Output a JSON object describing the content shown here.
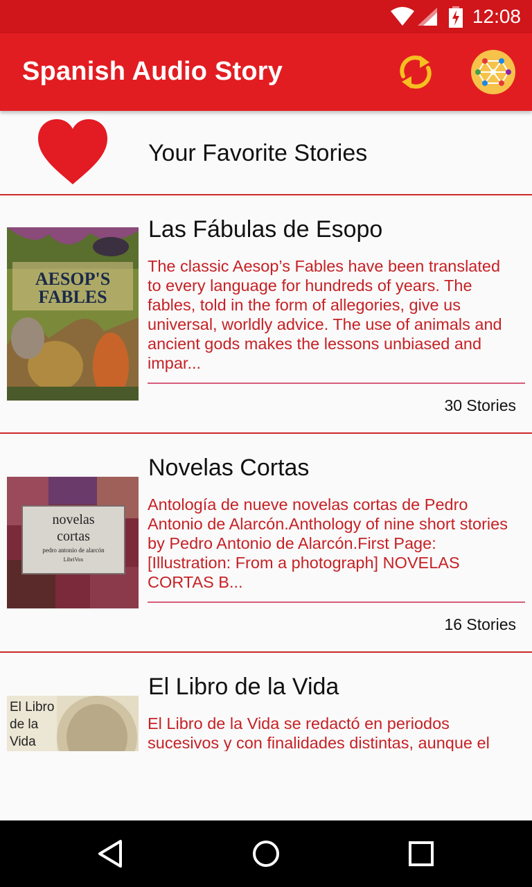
{
  "status_bar": {
    "time": "12:08"
  },
  "app_bar": {
    "title": "Spanish Audio Story"
  },
  "favorites": {
    "label": "Your Favorite Stories"
  },
  "stories": [
    {
      "title": "Las Fábulas de Esopo",
      "description": "The classic Aesop’s Fables have been translated to every language for hundreds of years. The fables, told in the form of allegories, give us universal, worldly advice. The use of animals and ancient gods makes the lessons unbiased and impar...",
      "count": "30 Stories",
      "cover_text": [
        "AESOP'S",
        "FABLES"
      ]
    },
    {
      "title": "Novelas Cortas",
      "description": "Antología de nueve novelas cortas de Pedro Antonio de Alarcón.Anthology of nine short stories by Pedro Antonio de Alarcón.First Page: [Illustration: From a photograph] NOVELAS CORTAS B...",
      "count": "16 Stories",
      "cover_text": [
        "novelas",
        "cortas",
        "pedro antonio de alarcón",
        "LibriVox"
      ]
    },
    {
      "title": "El Libro de la Vida",
      "description": "El Libro de la Vida se redactó en periodos sucesivos y con finalidades distintas, aunque el",
      "cover_text": [
        "El Libro",
        "de la",
        "Vida"
      ]
    }
  ],
  "colors": {
    "status_bar": "#d0161a",
    "app_bar": "#e21d22",
    "accent_red": "#c62125",
    "heart": "#e31b23",
    "refresh": "#f5c020"
  }
}
